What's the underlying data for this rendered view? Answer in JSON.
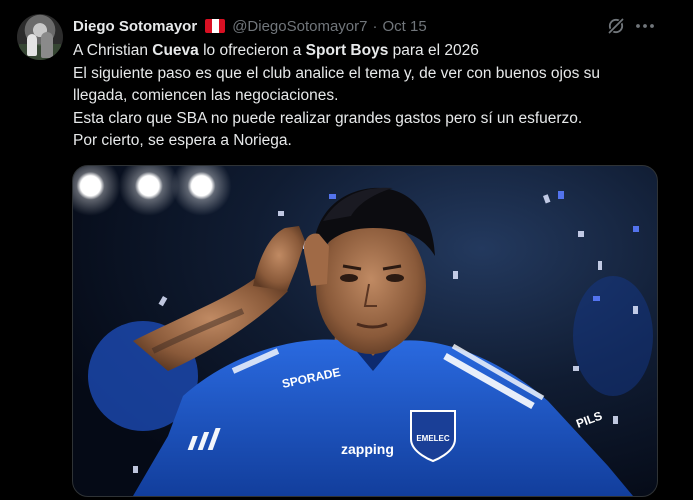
{
  "author": {
    "name": "Diego Sotomayor",
    "handle": "@DiegoSotomayor7",
    "separator": "·",
    "date": "Oct 15"
  },
  "post": {
    "line1": {
      "a": "A Christian ",
      "b": "Cueva",
      "c": " lo ofrecieron a ",
      "d": "Sport Boys",
      "e": " para el 2026"
    },
    "line2": "El siguiente paso es que el club analice el tema y, de ver con buenos ojos su",
    "line3": "llegada, comiencen las negociaciones.",
    "line4": "Esta claro que SBA no puede realizar grandes gastos pero sí un esfuerzo.",
    "line5": "Por cierto, se espera a Noriega."
  },
  "jersey": {
    "sponsor_chest": "zapping",
    "sponsor_sleeve": "SPORADE",
    "sponsor_shoulder": "PILS",
    "badge": "EMELEC"
  },
  "icons": {
    "grok": "grok-icon",
    "more": "more-icon",
    "flag": "peru-flag-icon"
  },
  "colors": {
    "background": "#000000",
    "text": "#e7e9ea",
    "muted": "#71767b",
    "jersey_blue": "#1b57c9"
  }
}
